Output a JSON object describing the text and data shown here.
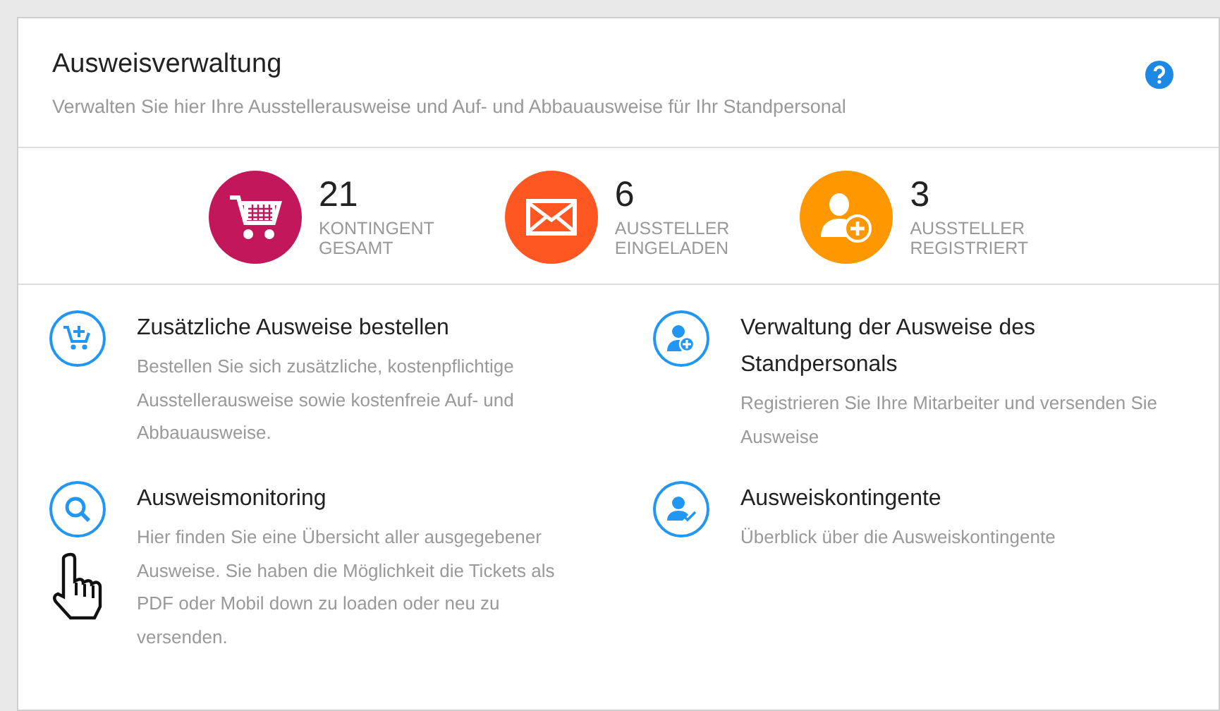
{
  "header": {
    "title": "Ausweisverwaltung",
    "subtitle": "Verwalten Sie hier Ihre Ausstellerausweise und Auf- und Abbauausweise für Ihr Standpersonal"
  },
  "stats": [
    {
      "kind": "cart",
      "color": "#c2185b",
      "value": "21",
      "label_line1": "KONTINGENT",
      "label_line2": "GESAMT"
    },
    {
      "kind": "mail",
      "color": "#ff5722",
      "value": "6",
      "label_line1": "AUSSTELLER",
      "label_line2": "EINGELADEN"
    },
    {
      "kind": "user-plus",
      "color": "#ff9800",
      "value": "3",
      "label_line1": "AUSSTELLER",
      "label_line2": "REGISTRIERT"
    }
  ],
  "actions": [
    {
      "kind": "cart-plus",
      "title": "Zusätzliche Ausweise bestellen",
      "description": "Bestellen Sie sich zusätzliche, kostenpflichtige Ausstellerausweise sowie kostenfreie Auf- und Abbauausweise."
    },
    {
      "kind": "user-plus",
      "title": "Verwaltung der Ausweise des Standpersonals",
      "description": "Registrieren Sie Ihre Mitarbeiter und versenden Sie Ausweise"
    },
    {
      "kind": "search",
      "title": "Ausweismonitoring",
      "description": "Hier finden Sie eine Übersicht aller ausgegebener Ausweise. Sie haben die Möglichkeit die Tickets als PDF oder Mobil down zu loaden oder neu zu versenden."
    },
    {
      "kind": "user-check",
      "title": "Ausweiskontingente",
      "description": "Überblick über die Ausweiskontingente"
    }
  ]
}
